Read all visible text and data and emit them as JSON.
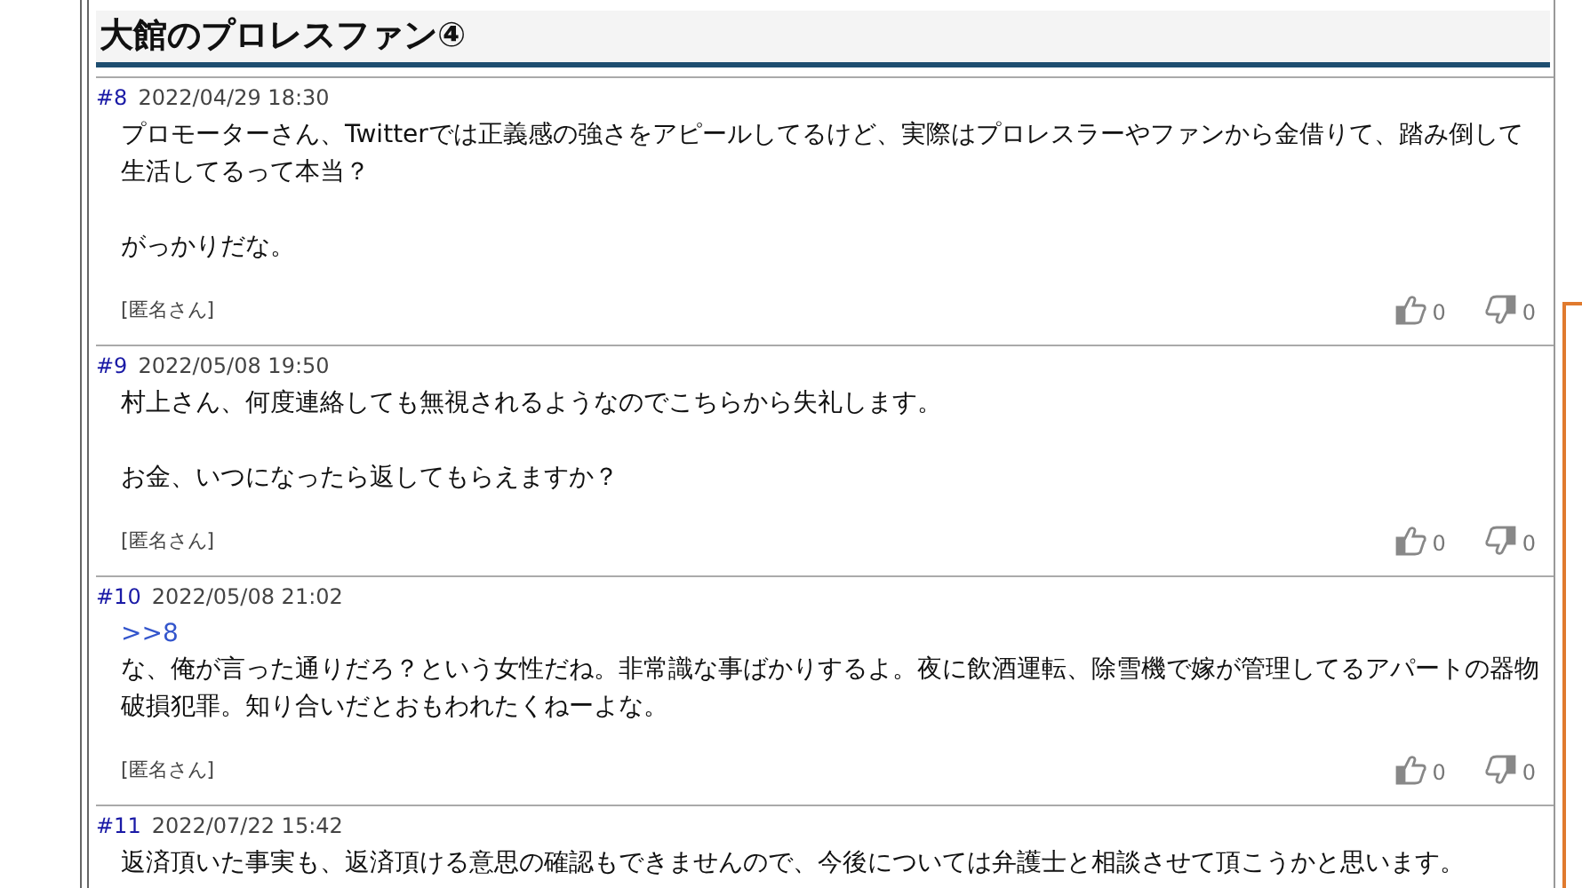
{
  "thread": {
    "title": "大館のプロレスファン④"
  },
  "comments": [
    {
      "number": "#8",
      "date": "2022/04/29 18:30",
      "paragraphs": [
        "プロモーターさん、Twitterでは正義感の強さをアピールしてるけど、実際はプロレスラーやファンから金借りて、踏み倒して生活してるって本当？",
        "がっかりだな。"
      ],
      "author": "[匿名さん]",
      "likes": "0",
      "dislikes": "0"
    },
    {
      "number": "#9",
      "date": "2022/05/08 19:50",
      "paragraphs": [
        "村上さん、何度連絡しても無視されるようなのでこちらから失礼します。",
        "お金、いつになったら返してもらえますか？"
      ],
      "author": "[匿名さん]",
      "likes": "0",
      "dislikes": "0"
    },
    {
      "number": "#10",
      "date": "2022/05/08 21:02",
      "reply_to": ">>8",
      "paragraphs": [
        "な、俺が言った通りだろ？という女性だね。非常識な事ばかりするよ。夜に飲酒運転、除雪機で嫁が管理してるアパートの器物破損犯罪。知り合いだとおもわれたくねーよな。"
      ],
      "author": "[匿名さん]",
      "likes": "0",
      "dislikes": "0"
    },
    {
      "number": "#11",
      "date": "2022/07/22 15:42",
      "paragraphs": [
        "返済頂いた事実も、返済頂ける意思の確認もできませんので、今後については弁護士と相談させて頂こうかと思います。"
      ]
    }
  ]
}
